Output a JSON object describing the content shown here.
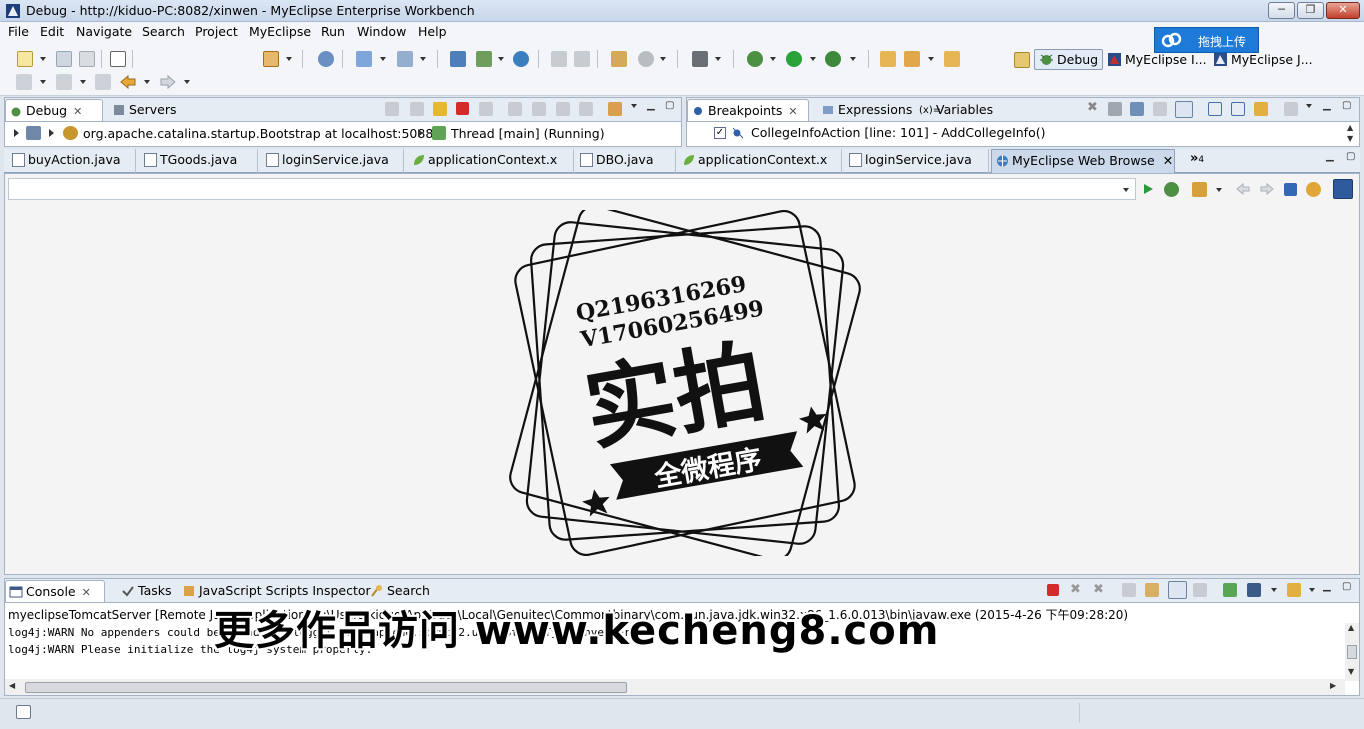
{
  "window": {
    "title": "Debug - http://kiduo-PC:8082/xinwen - MyEclipse Enterprise Workbench",
    "minimize": "─",
    "restore": "❐",
    "close": "✕"
  },
  "menu": [
    "File",
    "Edit",
    "Navigate",
    "Search",
    "Project",
    "MyEclipse",
    "Run",
    "Window",
    "Help"
  ],
  "perspectives": [
    {
      "label": "Debug",
      "active": true
    },
    {
      "label": "MyEclipse I...",
      "active": false
    },
    {
      "label": "MyEclipse J...",
      "active": false
    }
  ],
  "upload_badge": "拖拽上传",
  "debug_view": {
    "tabs": [
      {
        "label": "Debug",
        "close": "✕"
      },
      {
        "label": "Servers"
      }
    ],
    "tree": [
      "org.apache.catalina.startup.Bootstrap at localhost:50880",
      "Thread [main] (Running)"
    ]
  },
  "breakpoints_view": {
    "tabs": [
      {
        "label": "Breakpoints",
        "close": "✕"
      },
      {
        "label": "Expressions"
      },
      {
        "label": "Variables"
      }
    ],
    "items": [
      "CollegeInfoAction [line: 101] - AddCollegeInfo()"
    ]
  },
  "editor": {
    "tabs": [
      {
        "label": "buyAction.java"
      },
      {
        "label": "TGoods.java"
      },
      {
        "label": "loginService.java"
      },
      {
        "label": "applicationContext.x"
      },
      {
        "label": "DBO.java"
      },
      {
        "label": "applicationContext.x"
      },
      {
        "label": "loginService.java"
      },
      {
        "label": "MyEclipse Web Browse",
        "active": true
      }
    ],
    "overflow": "»",
    "overflow_count": "4",
    "close": "✕",
    "address_value": ""
  },
  "stamp": {
    "line1": "Q2196316269",
    "line2": "V17060256499",
    "main": "实拍",
    "banner": "全微程序"
  },
  "console_view": {
    "tabs": [
      {
        "label": "Console",
        "close": "✕"
      },
      {
        "label": "Tasks"
      },
      {
        "label": "JavaScript Scripts Inspector"
      },
      {
        "label": "Search"
      }
    ],
    "header": "myeclipseTomcatServer [Remote Java Application] C:\\Users\\kiduo\\AppData\\Local\\Genuitec\\Common\\binary\\com.sun.java.jdk.win32.x86_1.6.0.013\\bin\\javaw.exe (2015-4-26 下午09:28:20)",
    "lines": [
      "log4j:WARN No appenders could be found for logger (org.apache.struts2.util.StrutsTypeConverter).",
      "log4j:WARN Please initialize the log4j system properly."
    ]
  },
  "watermark": "更多作品访问 www.kecheng8.com"
}
